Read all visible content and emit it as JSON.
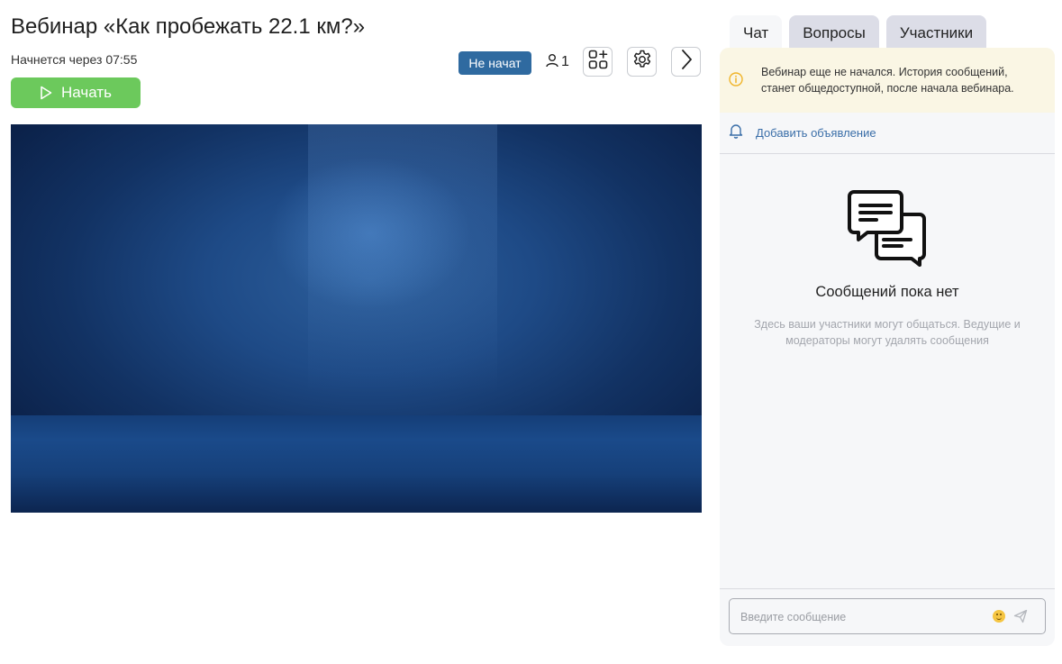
{
  "header": {
    "title": "Вебинар «Как пробежать 22.1 км?»",
    "countdown": "Начнется через 07:55",
    "start_label": "Начать",
    "status_badge": "Не начат",
    "participants_count": "1"
  },
  "video": {
    "background": "blue-stage"
  },
  "tabs": [
    {
      "label": "Чат",
      "active": true
    },
    {
      "label": "Вопросы",
      "active": false
    },
    {
      "label": "Участники",
      "active": false
    }
  ],
  "chat": {
    "notice": "Вебинар еще не начался. История сообщений, станет общедоступной, после начала вебинара.",
    "add_announcement": "Добавить объявление",
    "empty_title": "Сообщений пока нет",
    "empty_description": "Здесь ваши участники могут общаться. Ведущие и модераторы могут удалять сообщения",
    "input_placeholder": "Введите сообщение",
    "input_value": ""
  },
  "colors": {
    "start_button": "#6cc95c",
    "status_badge": "#2f6aa0",
    "notice_bg": "#faf6e4",
    "panel_bg": "#f6f7f9",
    "link": "#3a6ea8"
  },
  "icons": [
    "play-icon",
    "user-icon",
    "apps-add-icon",
    "gear-icon",
    "chevron-right-icon",
    "info-icon",
    "bell-icon",
    "chat-bubbles-icon",
    "emoji-icon",
    "send-icon"
  ]
}
